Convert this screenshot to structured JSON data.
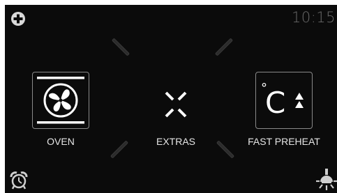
{
  "status": {
    "time": "10:15"
  },
  "icons": {
    "top_left": "plus-circle-icon",
    "bottom_left": "alarm-clock-icon",
    "bottom_right": "oven-light-icon"
  },
  "menu": {
    "oven_label": "OVEN",
    "extras_label": "EXTRAS",
    "fast_preheat_label": "FAST PREHEAT",
    "degree_symbol": "°",
    "celsius_letter": "C"
  },
  "colors": {
    "background": "#0b0b0b",
    "text": "#e6e6e6",
    "icon": "#ffffff",
    "muted": "#6a6a6a"
  }
}
